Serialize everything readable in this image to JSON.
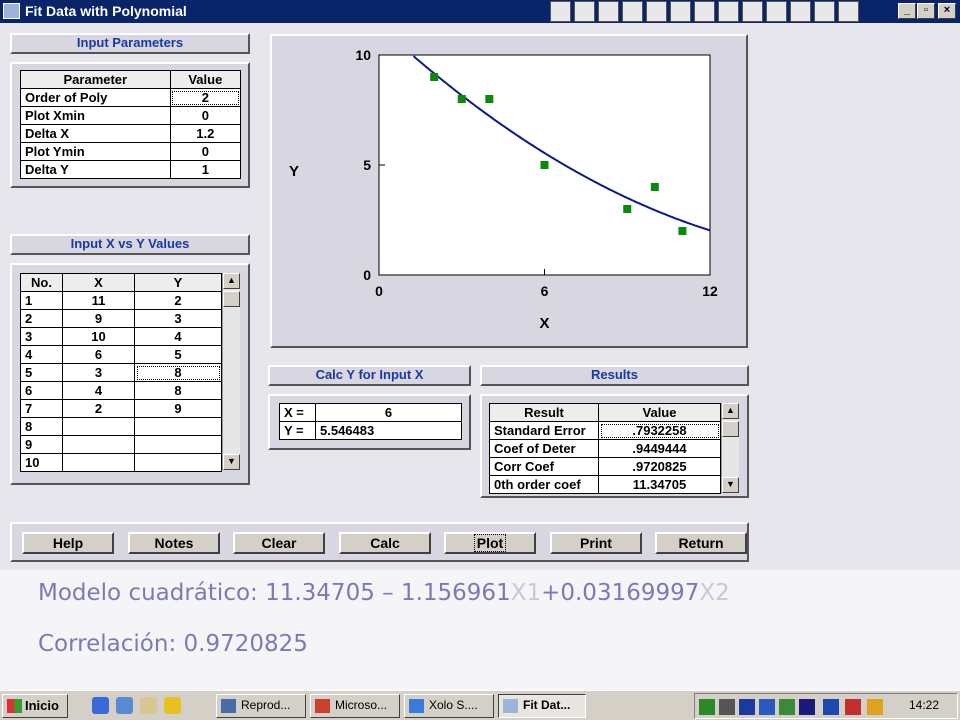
{
  "window": {
    "title": "Fit Data with Polynomial"
  },
  "input_params": {
    "header": "Input Parameters",
    "columns": [
      "Parameter",
      "Value"
    ],
    "rows": [
      [
        "Order of Poly",
        "2"
      ],
      [
        "Plot Xmin",
        "0"
      ],
      [
        "Delta X",
        "1.2"
      ],
      [
        "Plot Ymin",
        "0"
      ],
      [
        "Delta Y",
        "1"
      ]
    ]
  },
  "xy_values": {
    "header": "Input X vs Y Values",
    "columns": [
      "No.",
      "X",
      "Y"
    ],
    "rows": [
      [
        "1",
        "11",
        "2"
      ],
      [
        "2",
        "9",
        "3"
      ],
      [
        "3",
        "10",
        "4"
      ],
      [
        "4",
        "6",
        "5"
      ],
      [
        "5",
        "3",
        "8"
      ],
      [
        "6",
        "4",
        "8"
      ],
      [
        "7",
        "2",
        "9"
      ],
      [
        "8",
        "",
        ""
      ],
      [
        "9",
        "",
        ""
      ],
      [
        "10",
        "",
        ""
      ]
    ]
  },
  "chart_data": {
    "type": "scatter",
    "xlabel": "X",
    "ylabel": "Y",
    "xlim": [
      0,
      12
    ],
    "ylim": [
      0,
      10
    ],
    "xticks": [
      "0",
      "6",
      "12"
    ],
    "yticks": [
      "0",
      "5",
      "10"
    ],
    "points": [
      [
        2,
        9
      ],
      [
        3,
        8
      ],
      [
        4,
        8
      ],
      [
        6,
        5
      ],
      [
        9,
        3
      ],
      [
        10,
        4
      ],
      [
        11,
        2
      ]
    ],
    "fit": {
      "type": "polynomial",
      "coefficients": [
        11.34705,
        -1.156961,
        0.03169997
      ],
      "color": "#0a1a8c"
    },
    "point_color": "#0a8a0a",
    "grid": false
  },
  "calc": {
    "header": "Calc Y for Input X",
    "rows": [
      [
        "X =",
        "6"
      ],
      [
        "Y =",
        "5.546483"
      ]
    ]
  },
  "results": {
    "header": "Results",
    "columns": [
      "Result",
      "Value"
    ],
    "rows": [
      [
        "Standard Error",
        ".7932258"
      ],
      [
        "Coef of Deter",
        ".9449444"
      ],
      [
        "Corr Coef",
        ".9720825"
      ],
      [
        "0th order coef",
        "11.34705"
      ]
    ]
  },
  "buttons": {
    "help": "Help",
    "notes": "Notes",
    "clear": "Clear",
    "calc": "Calc",
    "plot": "Plot",
    "print": "Print",
    "return": "Return"
  },
  "slide": {
    "model_prefix": "Modelo cuadrático: 11.34705 – 1.156961",
    "x1": "X1",
    "model_mid": "+0.03169997",
    "x2": "X2",
    "correlation": "Correlación: 0.9720825"
  },
  "taskbar": {
    "start": "Inicio",
    "tasks": [
      "Reprod...",
      "Microso...",
      "Xolo S....",
      "Fit Dat..."
    ],
    "clock": "14:22"
  }
}
